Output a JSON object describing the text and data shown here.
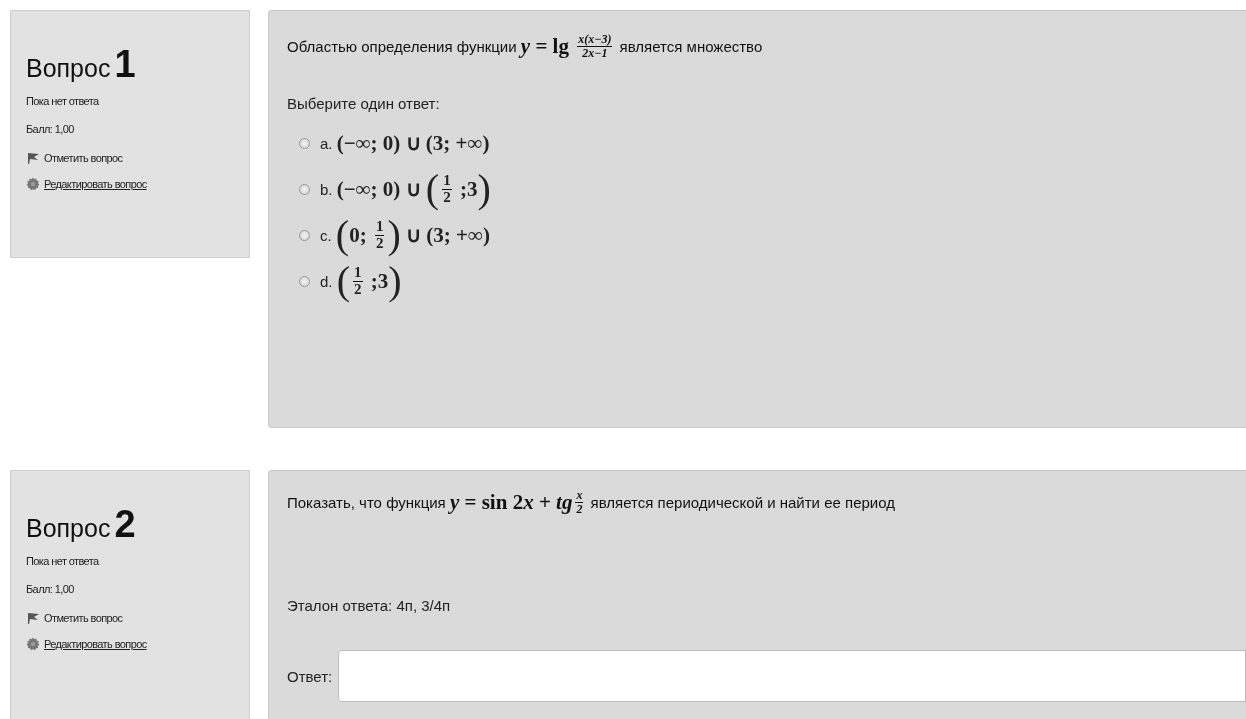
{
  "questions": [
    {
      "kind": "choice",
      "heading": "Вопрос",
      "number": "1",
      "status": "Пока нет ответа",
      "mark": "Балл: 1,00",
      "flag_link": "Отметить вопрос",
      "edit_link": "Редактировать вопрос",
      "text": [
        {
          "kind": "text",
          "t": "Областью определения функции "
        },
        {
          "kind": "var",
          "t": "y"
        },
        {
          "kind": "math",
          "t": " = lg "
        },
        {
          "kind": "frac",
          "num": "x(x−3)",
          "den": "2x−1"
        },
        {
          "kind": "text",
          "t": " является множество"
        }
      ],
      "prompt": "Выберите один ответ:",
      "options": [
        {
          "letter": "a.",
          "selected": false,
          "math": [
            {
              "kind": "math",
              "t": "(−∞; 0) ∪ (3; +∞)"
            }
          ]
        },
        {
          "letter": "b.",
          "selected": false,
          "math": [
            {
              "kind": "math",
              "t": "(−∞; 0) ∪ "
            },
            {
              "kind": "big",
              "t": "("
            },
            {
              "kind": "frac",
              "num": "1",
              "den": "2"
            },
            {
              "kind": "math",
              "t": " ;3"
            },
            {
              "kind": "big",
              "t": ")"
            }
          ]
        },
        {
          "letter": "c.",
          "selected": false,
          "math": [
            {
              "kind": "big",
              "t": "("
            },
            {
              "kind": "math",
              "t": "0; "
            },
            {
              "kind": "frac",
              "num": "1",
              "den": "2"
            },
            {
              "kind": "big",
              "t": ")"
            },
            {
              "kind": "math",
              "t": " ∪ (3; +∞)"
            }
          ]
        },
        {
          "letter": "d.",
          "selected": false,
          "math": [
            {
              "kind": "big",
              "t": "("
            },
            {
              "kind": "frac",
              "num": "1",
              "den": "2"
            },
            {
              "kind": "math",
              "t": " ;3"
            },
            {
              "kind": "big",
              "t": ")"
            }
          ]
        }
      ]
    },
    {
      "kind": "short",
      "heading": "Вопрос",
      "number": "2",
      "status": "Пока нет ответа",
      "mark": "Балл: 1,00",
      "flag_link": "Отметить вопрос",
      "edit_link": "Редактировать вопрос",
      "text": [
        {
          "kind": "text",
          "t": "Показать, что функция "
        },
        {
          "kind": "var",
          "t": "y"
        },
        {
          "kind": "math",
          "t": " = sin 2"
        },
        {
          "kind": "var",
          "t": "x"
        },
        {
          "kind": "math",
          "t": " + "
        },
        {
          "kind": "var",
          "t": "tg"
        },
        {
          "kind": "frac",
          "num": "x",
          "den": "2"
        },
        {
          "kind": "text",
          "t": " является периодической и найти ее период"
        }
      ],
      "reference": "Эталон ответа: 4п, 3/4п",
      "answer_label": "Ответ:"
    }
  ]
}
